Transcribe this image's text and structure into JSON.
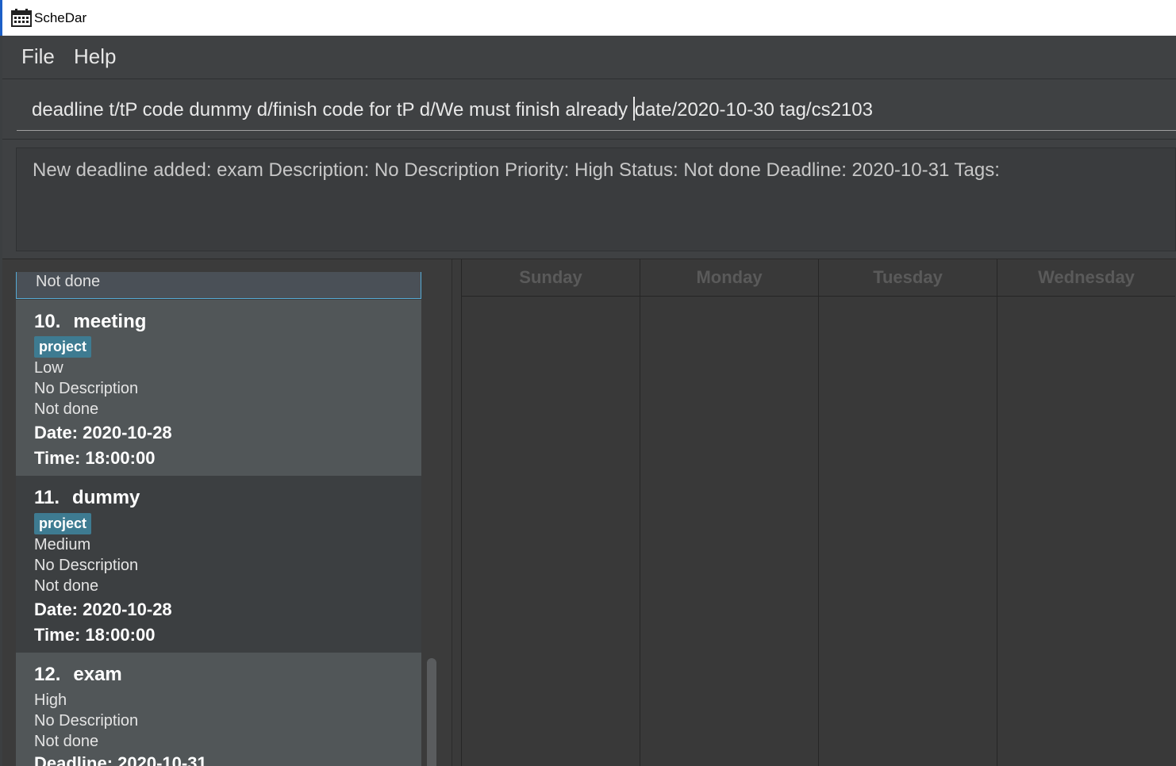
{
  "window": {
    "title": "ScheDar",
    "icon": "calendar-icon"
  },
  "menu": {
    "file": "File",
    "help": "Help"
  },
  "command": {
    "before_caret": "deadline t/tP code dummy d/finish code for tP d/We must finish already ",
    "after_caret": "date/2020-10-30 tag/cs2103"
  },
  "result": {
    "message": "New deadline added: exam Description: No Description Priority: High Status: Not done Deadline: 2020-10-31 Tags:"
  },
  "task_list": {
    "partial_top_status": "Not done",
    "items": [
      {
        "index": "10.",
        "name": "meeting",
        "tag": "project",
        "priority": "Low",
        "description": "No Description",
        "status": "Not done",
        "date": "Date: 2020-10-28",
        "time": "Time: 18:00:00"
      },
      {
        "index": "11.",
        "name": "dummy",
        "tag": "project",
        "priority": "Medium",
        "description": "No Description",
        "status": "Not done",
        "date": "Date: 2020-10-28",
        "time": "Time: 18:00:00"
      },
      {
        "index": "12.",
        "name": "exam",
        "priority": "High",
        "description": "No Description",
        "status": "Not done",
        "deadline": "Deadline: 2020-10-31"
      }
    ]
  },
  "calendar": {
    "days": [
      "Sunday",
      "Monday",
      "Tuesday",
      "Wednesday"
    ]
  },
  "colors": {
    "tag_bg": "#3e7b91",
    "selected_border": "#55aad4",
    "card_light": "#515658",
    "card_dark": "#3c3f41"
  }
}
